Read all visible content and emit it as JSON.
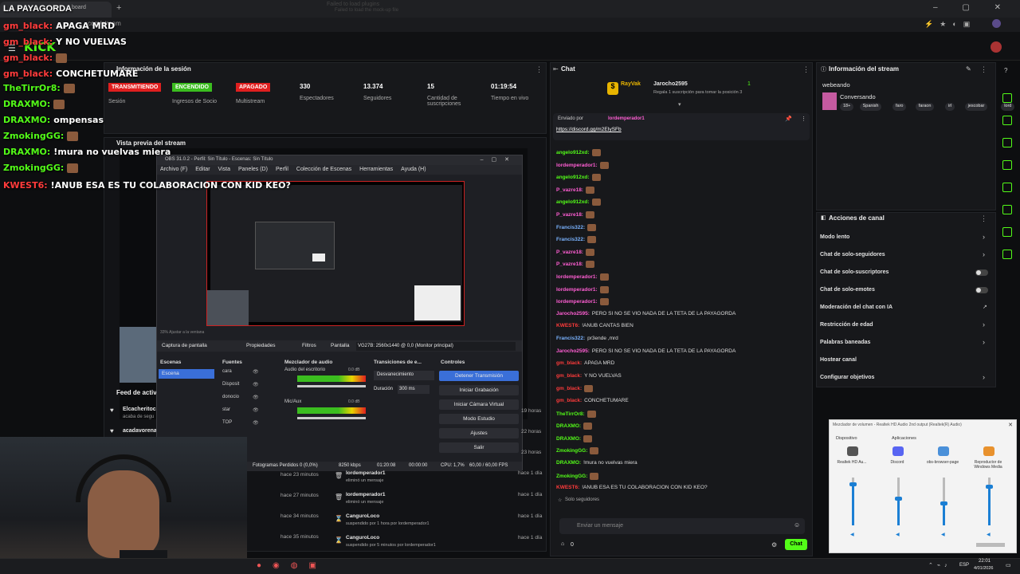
{
  "browser": {
    "tab_title": "LA PAYAGORDA",
    "tab_suffix": "board",
    "url": "com/stream",
    "ghost_1": "Failed to load plugins",
    "ghost_2": "Failed to load the mock-up file"
  },
  "kick": {
    "logo": "KICK"
  },
  "overlay_chat": {
    "lines": [
      {
        "user": "gm_black:",
        "msg": "APAGA MRD",
        "red": true
      },
      {
        "user": "gm_black:",
        "msg": "Y NO VUELVAS",
        "red": true
      },
      {
        "user": "gm_black:",
        "msg": "",
        "red": true
      },
      {
        "user": "gm_black:",
        "msg": "CONCHETUMARE",
        "red": true
      },
      {
        "user": "TheTirrOr8:",
        "msg": "",
        "red": false
      },
      {
        "user": "DRAXMO:",
        "msg": "",
        "red": false
      },
      {
        "user": "DRAXMO:",
        "msg": "ompensas",
        "red": false
      },
      {
        "user": "ZmokingGG:",
        "msg": "",
        "red": false
      },
      {
        "user": "DRAXMO:",
        "msg": "!mura no vuelvas miera",
        "red": false
      },
      {
        "user": "ZmokingGG:",
        "msg": "",
        "red": false
      },
      {
        "user": "KWEST6:",
        "msg": "!ANUB ESA ES TU COLABORACION CON KID KEO?",
        "red": true
      }
    ]
  },
  "session": {
    "title": "Información de la sesión",
    "badges": [
      {
        "value": "TRANSMITIENDO",
        "label": "Sesión",
        "color": "#e01f1f"
      },
      {
        "value": "ENCENDIDO",
        "label": "Ingresos de Socio",
        "color": "#3bbd1f"
      },
      {
        "value": "APAGADO",
        "label": "Multistream",
        "color": "#e01f1f"
      }
    ],
    "stats": [
      {
        "value": "330",
        "label": "Espectadores"
      },
      {
        "value": "13.374",
        "label": "Seguidores"
      },
      {
        "value": "15",
        "label": "Cantidad de suscripciones"
      },
      {
        "value": "01:19:54",
        "label": "Tiempo en vivo"
      }
    ]
  },
  "preview": {
    "title": "Vista previa del stream",
    "activity": "Feed de activi",
    "act_user_1": "Elcacheritoc",
    "act_sub_1": "acaba de segu",
    "act_user_2": "acadavorena"
  },
  "obs": {
    "title": "OBS 31.0.2 - Perfil: Sin Título - Escenas: Sin Título",
    "menu": [
      "Archivo (F)",
      "Editar",
      "Vista",
      "Paneles (D)",
      "Perfil",
      "Colección de Escenas",
      "Herramientas",
      "Ayuda (H)"
    ],
    "source_bar": {
      "capture": "Captura de pantalla",
      "props": "Propiedades",
      "filters": "Filtros",
      "screen_label": "Pantalla",
      "screen_value": "VG27B: 2560x1440 @ 0,0 (Monitor principal)"
    },
    "docks": {
      "scenes": "Escenas",
      "sources": "Fuentes",
      "mixer": "Mezclador de audio",
      "transitions": "Transiciones de e...",
      "controls": "Controles"
    },
    "scene_item": "Escena",
    "sources": [
      "cara",
      "Disposit",
      "donocio",
      "star",
      "TOP"
    ],
    "mixer_channels": [
      {
        "name": "Audio del escritorio",
        "db": "0.0 dB"
      },
      {
        "name": "Mic/Aux",
        "db": "0.0 dB"
      }
    ],
    "transition": {
      "value": "Desvanecimiento",
      "duration_label": "Duración",
      "duration_value": "300 ms"
    },
    "controls": [
      "Detener Transmisión",
      "Iniciar Grabación",
      "Iniciar Cámara Virtual",
      "Modo Estudio",
      "Ajustes",
      "Salir"
    ],
    "status": {
      "frames": "Fotogramas Perdidos 0 (0,0%)",
      "kbps": "8250 kbps",
      "time": "01:20:08",
      "time2": "00:00:00",
      "cpu": "CPU: 1,7%",
      "fps": "60,00 / 60,00 FPS"
    },
    "zoom": "33%  Ajustar a la ventana"
  },
  "mod_log": {
    "times_left": [
      "hace 23 minutos",
      "hace 27 minutos",
      "hace 34 minutos",
      "hace 35 minutos"
    ],
    "times_side": [
      "19 horas",
      "22 horas",
      "23 horas"
    ],
    "rows": [
      {
        "user": "lordemperador1",
        "action": "eliminó un mensaje",
        "time": "hace 1 día"
      },
      {
        "user": "lordemperador1",
        "action": "eliminó un mensaje",
        "time": "hace 1 día"
      },
      {
        "user": "CanguroLoco",
        "action": "suspendido por 1 hora por lordemperador1",
        "time": "hace 1 día"
      },
      {
        "user": "CanguroLoco",
        "action": "suspendido por 5 minutos por lordemperador1",
        "time": "hace 1 día"
      }
    ]
  },
  "chat": {
    "title": "Chat",
    "gift": {
      "user": "RayVak",
      "target": "Jarocho2595",
      "count": "1",
      "sub": "Regala 1 suscripción para tomar la posición 3"
    },
    "pinned": {
      "label": "Enviado por",
      "user": "lordemperador1",
      "link": "https://discord.gg/m2EIySFb"
    },
    "messages": [
      {
        "user": "angelo912xd:",
        "msg": "",
        "c": "g"
      },
      {
        "user": "lordemperador1:",
        "msg": "",
        "c": "p"
      },
      {
        "user": "angelo912xd:",
        "msg": "",
        "c": "g"
      },
      {
        "user": "P_vazre18:",
        "msg": "",
        "c": "p"
      },
      {
        "user": "angelo912xd:",
        "msg": "",
        "c": "g"
      },
      {
        "user": "P_vazre18:",
        "msg": "",
        "c": "p"
      },
      {
        "user": "Francis322:",
        "msg": "",
        "c": "b"
      },
      {
        "user": "Francis322:",
        "msg": "",
        "c": "b"
      },
      {
        "user": "P_vazre18:",
        "msg": "",
        "c": "p"
      },
      {
        "user": "P_vazre18:",
        "msg": "",
        "c": "p"
      },
      {
        "user": "lordemperador1:",
        "msg": "",
        "c": "p"
      },
      {
        "user": "lordemperador1:",
        "msg": "",
        "c": "p"
      },
      {
        "user": "lordemperador1:",
        "msg": "",
        "c": "p"
      },
      {
        "user": "Jarocho2595:",
        "msg": "PERO SI NO SE VIO NADA DE LA TETA DE LA PAYAGORDA",
        "c": "p"
      },
      {
        "user": "KWEST6:",
        "msg": "!ANUB CANTAS BIEN",
        "c": "r"
      },
      {
        "user": "Francis322:",
        "msg": "pr3ende ,mrd",
        "c": "b"
      },
      {
        "user": "Jarocho2595:",
        "msg": "PERO SI NO SE VIO NADA DE LA TETA DE LA PAYAGORDA",
        "c": "p"
      },
      {
        "user": "gm_black:",
        "msg": "APAGA MRD",
        "c": "r"
      },
      {
        "user": "gm_black:",
        "msg": "Y NO VUELVAS",
        "c": "r"
      },
      {
        "user": "gm_black:",
        "msg": "",
        "c": "r"
      },
      {
        "user": "gm_black:",
        "msg": "CONCHETUMARE",
        "c": "r"
      },
      {
        "user": "TheTirrOr8:",
        "msg": "",
        "c": "g"
      },
      {
        "user": "DRAXMO:",
        "msg": "",
        "c": "g"
      },
      {
        "user": "DRAXMO:",
        "msg": "",
        "c": "g"
      },
      {
        "user": "ZmokingGG:",
        "msg": "",
        "c": "g"
      },
      {
        "user": "DRAXMO:",
        "msg": "!mura no vuelvas miera",
        "c": "g"
      },
      {
        "user": "ZmokingGG:",
        "msg": "",
        "c": "g"
      },
      {
        "user": "KWEST6:",
        "msg": "!ANUB ESA ES TU COLABORACION CON KID KEO?",
        "c": "r"
      }
    ],
    "followers_only": "Solo seguidores",
    "input_placeholder": "Enviar un mensaje",
    "count": "0",
    "send": "Chat"
  },
  "stream_info": {
    "title": "Información del stream",
    "stream_title": "webeando",
    "category": "Conversando",
    "tags": [
      "18+",
      "Spanish",
      "faro",
      "faraon",
      "irl",
      "jescobar",
      "lord"
    ]
  },
  "channel_actions": {
    "title": "Acciones de canal",
    "items": [
      {
        "label": "Modo lento",
        "kind": "chevron"
      },
      {
        "label": "Chat de solo-seguidores",
        "kind": "chevron"
      },
      {
        "label": "Chat de solo-suscriptores",
        "kind": "toggle"
      },
      {
        "label": "Chat de solo-emotes",
        "kind": "toggle"
      },
      {
        "label": "Moderación del chat con IA",
        "kind": "link"
      },
      {
        "label": "Restricción de edad",
        "kind": "chevron"
      },
      {
        "label": "Palabras baneadas",
        "kind": "chevron"
      },
      {
        "label": "Hostear canal",
        "kind": "none"
      },
      {
        "label": "Configurar objetivos",
        "kind": "chevron"
      }
    ]
  },
  "volume_mixer": {
    "title": "Mezclador de volumen - Realtek HD Audio 2nd output (Realtek(R) Audio)",
    "device_label": "Dispositivo",
    "apps_label": "Aplicaciones",
    "channels": [
      {
        "name": "Realtek HD Au...",
        "level": 0.85
      },
      {
        "name": "Discord",
        "level": 0.55
      },
      {
        "name": "obs-browser-page",
        "level": 0.45
      },
      {
        "name": "Reproductor de Windows Media",
        "level": 0.8
      }
    ]
  },
  "taskbar": {
    "lang": "ESP",
    "time": "22:01",
    "date": "4/01/2026"
  }
}
